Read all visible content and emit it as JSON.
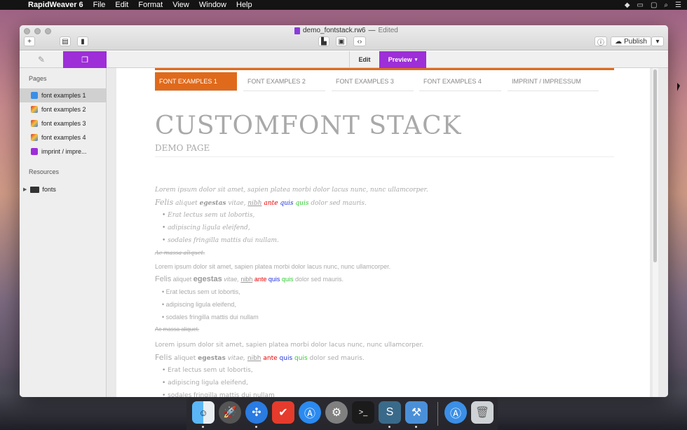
{
  "menubar": {
    "app": "RapidWeaver 6",
    "items": [
      "File",
      "Edit",
      "Format",
      "View",
      "Window",
      "Help"
    ]
  },
  "window": {
    "doc_title": "demo_fontstack.rw6",
    "dash": "—",
    "status": "Edited",
    "publish_label": "Publish",
    "tab_edit": "Edit",
    "tab_preview": "Preview"
  },
  "sidebar": {
    "pages_header": "Pages",
    "pages": [
      {
        "label": "font examples 1",
        "selected": true
      },
      {
        "label": "font examples 2"
      },
      {
        "label": "font examples 3"
      },
      {
        "label": "font examples 4"
      },
      {
        "label": "imprint / impre..."
      }
    ],
    "resources_header": "Resources",
    "resources": [
      {
        "label": "fonts"
      }
    ]
  },
  "preview": {
    "nav": [
      "FONT EXAMPLES 1",
      "FONT EXAMPLES 2",
      "FONT EXAMPLES 3",
      "FONT EXAMPLES 4",
      "IMPRINT / IMPRESSUM"
    ],
    "title": "CUSTOMFONT STACK",
    "subtitle": "DEMO PAGE",
    "para1": "Lorem ipsum dolor sit amet, sapien platea morbi dolor lacus nunc, nunc ullamcorper.",
    "felis": "Felis",
    "aliquet": "aliquet",
    "egestas": "egestas",
    "vitae": "vitae,",
    "nibh": "nibh",
    "ante": "ante",
    "quis1": "quis",
    "quis2": "quis",
    "tail": "dolor sed mauris.",
    "bullets": [
      "Erat lectus sem ut lobortis,",
      "adipiscing ligula eleifend,",
      "sodales fringilla mattis dui nullam."
    ],
    "bullets_b": [
      "Erat lectus sem ut lobortis,",
      "adipiscing ligula eleifend,",
      "sodales fringilla mattis dui nullam"
    ],
    "strike": "Ac massa aliquet."
  },
  "dock": [
    "Finder",
    "Launchpad",
    "Safari",
    "Wunderlist",
    "App Store",
    "System Preferences",
    "Terminal",
    "Sketch",
    "Xcode",
    "Downloads",
    "Trash"
  ],
  "colors": {
    "accent": "#9d2ed8",
    "nav_active": "#e06a1b"
  }
}
